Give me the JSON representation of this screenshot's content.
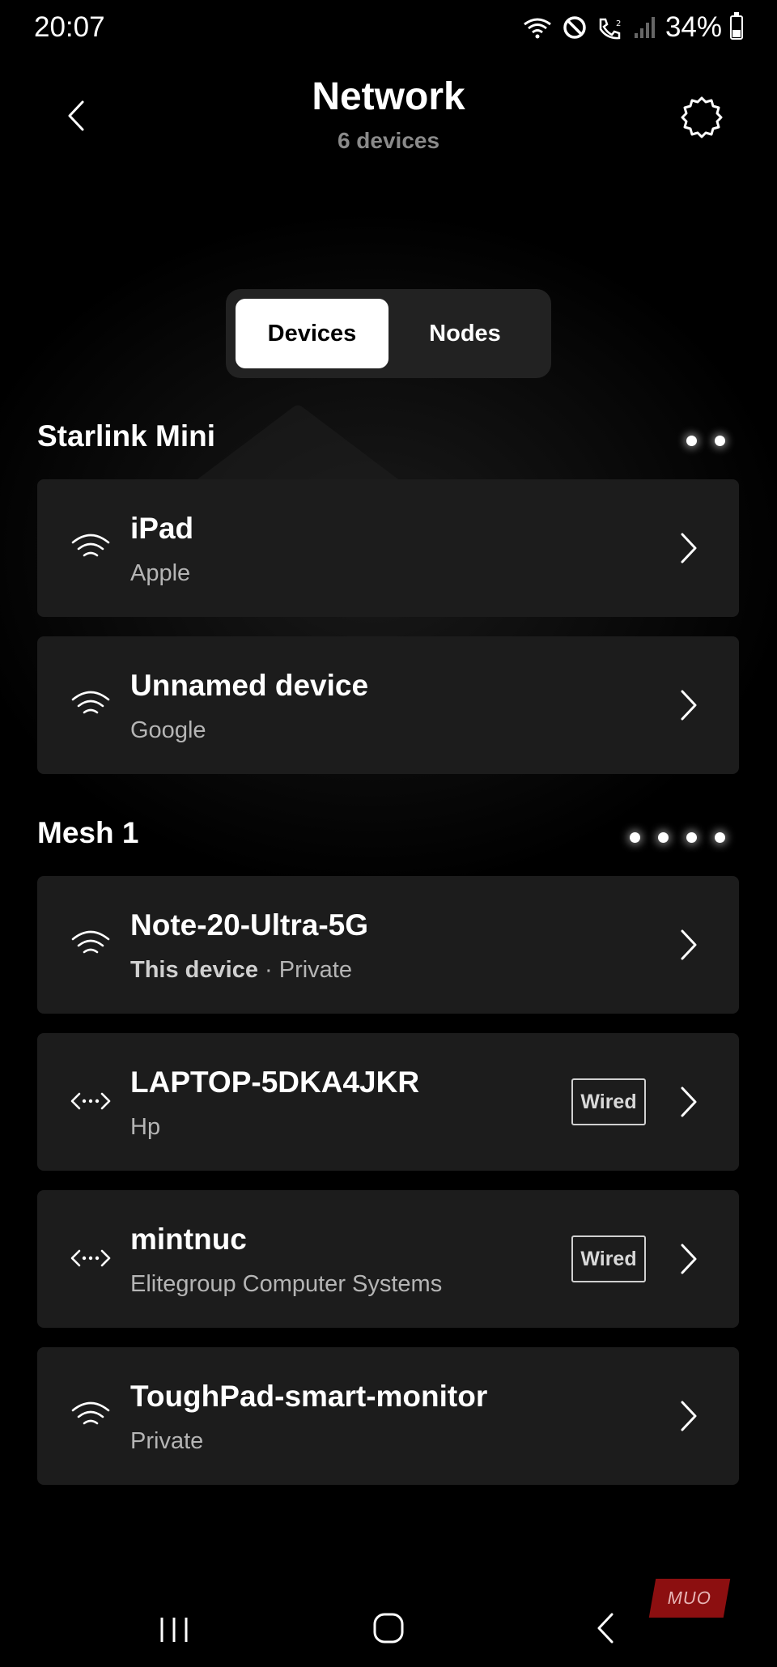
{
  "status_bar": {
    "time": "20:07",
    "battery_text": "34%"
  },
  "header": {
    "title": "Network",
    "subtitle": "6 devices"
  },
  "tabs": [
    {
      "label": "Devices",
      "active": true
    },
    {
      "label": "Nodes",
      "active": false
    }
  ],
  "sections": [
    {
      "title": "Starlink Mini",
      "devices": [
        {
          "name": "iPad",
          "sub": "Apple",
          "connection": "wifi-icon"
        },
        {
          "name": "Unnamed device",
          "sub": "Google",
          "connection": "wifi-icon"
        }
      ]
    },
    {
      "title": "Mesh 1",
      "devices": [
        {
          "name": "Note-20-Ultra-5G",
          "sub_strong": "This device",
          "sub": " · Private",
          "connection": "wifi-icon"
        },
        {
          "name": "LAPTOP-5DKA4JKR",
          "sub": "Hp",
          "connection": "ethernet-icon",
          "badge": "Wired"
        },
        {
          "name": "mintnuc",
          "sub": "Elitegroup Computer Systems",
          "connection": "ethernet-icon",
          "badge": "Wired"
        },
        {
          "name": "ToughPad-smart-monitor",
          "sub": "Private",
          "connection": "wifi-icon"
        }
      ]
    }
  ],
  "watermark": "MUO",
  "colors": {
    "background": "#000000",
    "card": "#1c1c1c",
    "accent_active_tab": "#ffffff"
  }
}
